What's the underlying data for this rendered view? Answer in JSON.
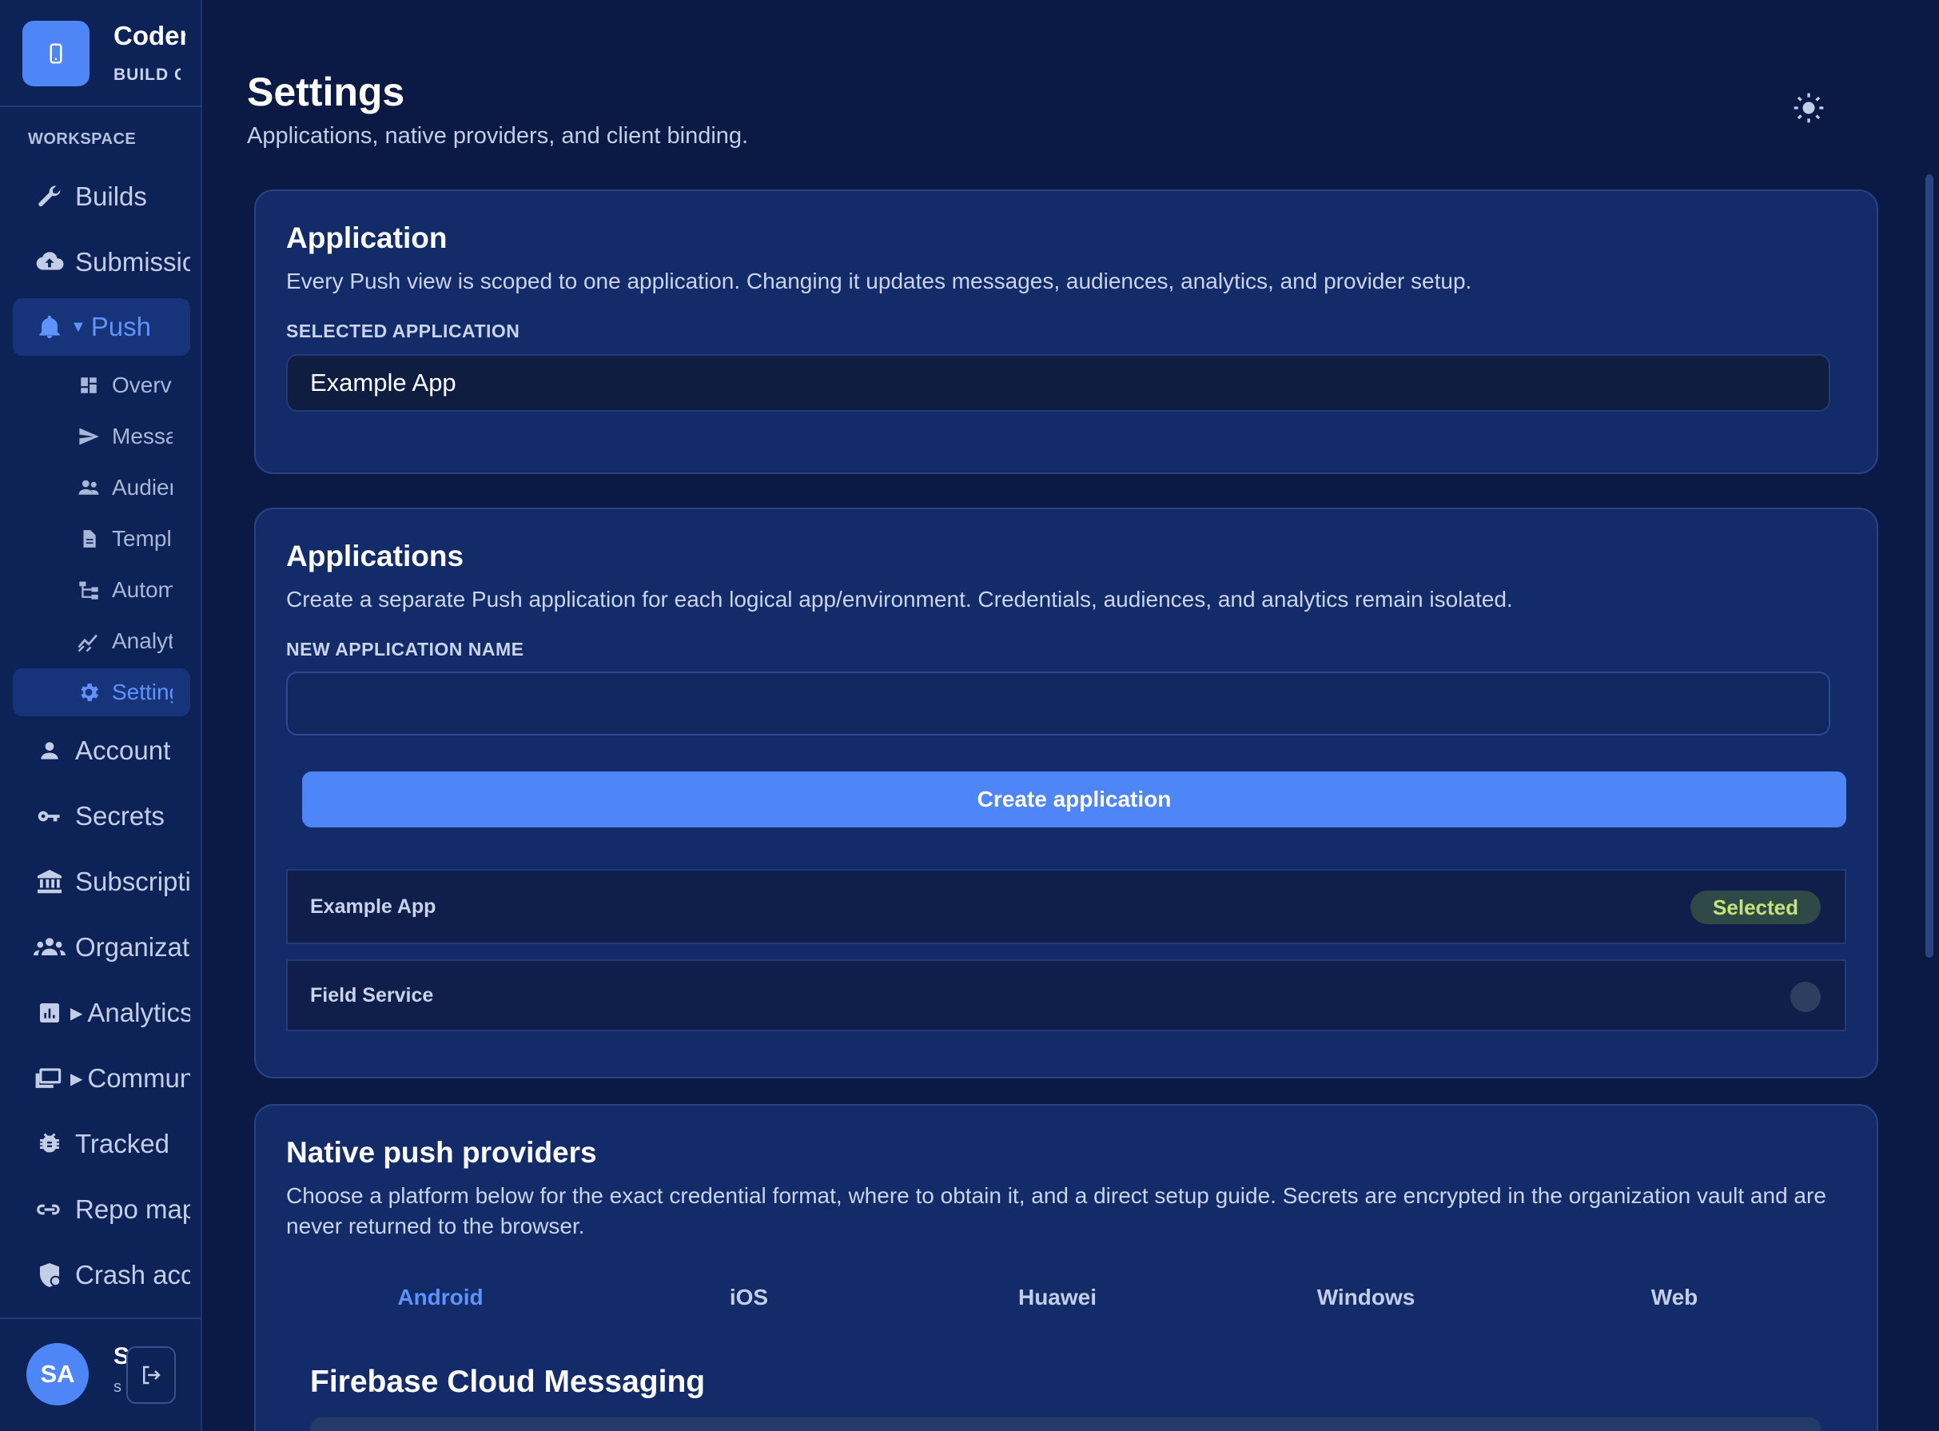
{
  "brand": {
    "title": "Codename One",
    "subtitle": "BUILD CLOUD"
  },
  "sidebar": {
    "section_label": "WORKSPACE",
    "items": [
      {
        "label": "Builds",
        "icon": "wrench-icon"
      },
      {
        "label": "Submissions",
        "icon": "cloud-upload-icon"
      },
      {
        "label": "Push",
        "icon": "bell-icon",
        "active": true,
        "expanded": true
      },
      {
        "label": "Account",
        "icon": "person-icon"
      },
      {
        "label": "Secrets",
        "icon": "key-icon"
      },
      {
        "label": "Subscription",
        "icon": "bank-icon"
      },
      {
        "label": "Organization",
        "icon": "group-icon"
      },
      {
        "label": "Analytics",
        "icon": "chart-icon",
        "collapsed": true
      },
      {
        "label": "Community",
        "icon": "display-icon",
        "collapsed": true
      },
      {
        "label": "Tracked",
        "icon": "bug-icon"
      },
      {
        "label": "Repo mapping",
        "icon": "link-icon"
      },
      {
        "label": "Crash access",
        "icon": "shield-icon"
      }
    ],
    "push_subitems": [
      {
        "label": "Overview",
        "icon": "dashboard-icon"
      },
      {
        "label": "Messages",
        "icon": "send-icon"
      },
      {
        "label": "Audiences",
        "icon": "people-icon"
      },
      {
        "label": "Templates",
        "icon": "document-icon"
      },
      {
        "label": "Automations",
        "icon": "flow-icon"
      },
      {
        "label": "Analytics",
        "icon": "trend-icon"
      },
      {
        "label": "Settings",
        "icon": "gear-icon",
        "active": true
      }
    ],
    "footer": {
      "avatar_initials": "SA",
      "name": "S",
      "email": "s"
    }
  },
  "header": {
    "title": "Settings",
    "subtitle": "Applications, native providers, and client binding."
  },
  "application_card": {
    "title": "Application",
    "description": "Every Push view is scoped to one application. Changing it updates messages, audiences, analytics, and provider setup.",
    "selected_label": "SELECTED APPLICATION",
    "selected_value": "Example App"
  },
  "applications_card": {
    "title": "Applications",
    "description": "Create a separate Push application for each logical app/environment. Credentials, audiences, and analytics remain isolated.",
    "new_name_label": "NEW APPLICATION NAME",
    "new_name_value": "",
    "create_button": "Create application",
    "apps": [
      {
        "name": "Example App",
        "status": "Selected"
      },
      {
        "name": "Field Service",
        "status": ""
      }
    ]
  },
  "providers_card": {
    "title": "Native push providers",
    "description": "Choose a platform below for the exact credential format, where to obtain it, and a direct setup guide. Secrets are encrypted in the organization vault and are never returned to the browser.",
    "tabs": [
      "Android",
      "iOS",
      "Huawei",
      "Windows",
      "Web"
    ],
    "active_tab": "Android",
    "provider_title": "Firebase Cloud Messaging"
  },
  "colors": {
    "background": "#0b1a45",
    "sidebar": "#0d2257",
    "card": "#132b69",
    "accent": "#4e85f7",
    "active_text": "#5d93fb",
    "selected_badge_text": "#c6e07a"
  }
}
